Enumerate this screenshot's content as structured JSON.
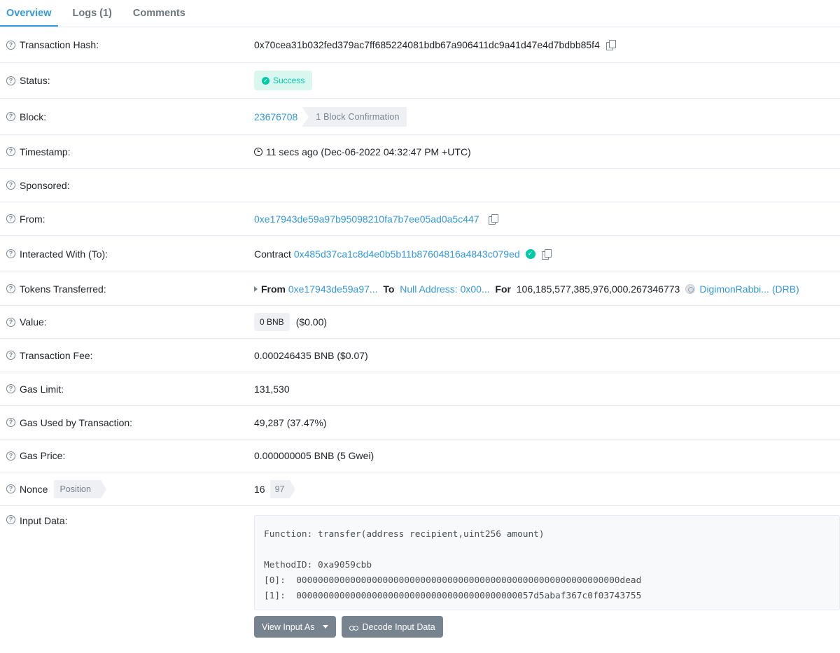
{
  "tabs": [
    {
      "label": "Overview",
      "active": true
    },
    {
      "label": "Logs (1)",
      "active": false
    },
    {
      "label": "Comments",
      "active": false
    }
  ],
  "rows": {
    "tx_hash": {
      "label": "Transaction Hash:",
      "value": "0x70cea31b032fed379ac7ff685224081bdb67a906411dc9a41d47e4d7bdbb85f4"
    },
    "status": {
      "label": "Status:",
      "value": "Success"
    },
    "block": {
      "label": "Block:",
      "number": "23676708",
      "confirmations": "1 Block Confirmation"
    },
    "timestamp": {
      "label": "Timestamp:",
      "value": "11 secs ago (Dec-06-2022 04:32:47 PM +UTC)"
    },
    "sponsored": {
      "label": "Sponsored:"
    },
    "from": {
      "label": "From:",
      "value": "0xe17943de59a97b95098210fa7b7ee05ad0a5c447"
    },
    "to": {
      "label": "Interacted With (To):",
      "prefix": "Contract",
      "address": "0x485d37ca1c8d4e0b5b11b87604816a4843c079ed"
    },
    "tokens": {
      "label": "Tokens Transferred:",
      "from_label": "From",
      "from_value": "0xe17943de59a97...",
      "to_label": "To",
      "to_value": "Null Address: 0x00...",
      "for_label": "For",
      "amount": "106,185,577,385,976,000.267346773",
      "token": "DigimonRabbi... (DRB)"
    },
    "value": {
      "label": "Value:",
      "pill": "0 BNB",
      "usd": "($0.00)"
    },
    "fee": {
      "label": "Transaction Fee:",
      "value": "0.000246435 BNB ($0.07)"
    },
    "gas_limit": {
      "label": "Gas Limit:",
      "value": "131,530"
    },
    "gas_used": {
      "label": "Gas Used by Transaction:",
      "value": "49,287 (37.47%)"
    },
    "gas_price": {
      "label": "Gas Price:",
      "value": "0.000000005 BNB (5 Gwei)"
    },
    "nonce": {
      "label": "Nonce",
      "position_label": "Position",
      "value": "16",
      "position": "97"
    },
    "input": {
      "label": "Input Data:",
      "text": "Function: transfer(address recipient,uint256 amount)\n\nMethodID: 0xa9059cbb\n[0]:  000000000000000000000000000000000000000000000000000000000000dead\n[1]:  00000000000000000000000000000000000000000057d5abaf367c0f03743755",
      "view_button": "View Input As",
      "decode_button": "Decode Input Data"
    }
  },
  "colors": {
    "link": "#3498db",
    "success": "#00c9a7",
    "muted": "#77838f"
  },
  "icons": {
    "help": "question-circle-icon",
    "copy": "copy-icon",
    "clock": "clock-icon",
    "check": "check-circle-icon"
  }
}
